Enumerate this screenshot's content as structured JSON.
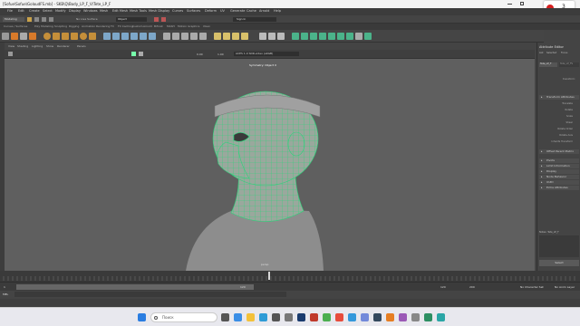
{
  "window": {
    "title": "[Sofue\\Sofue\\GoloudFS.mb] - SKB\\Q\\Body_LP_F_V\\Tete_LP_F"
  },
  "recording": {
    "count": "3"
  },
  "menu": [
    "File",
    "Edit",
    "Create",
    "Select",
    "Modify",
    "Display",
    "Windows",
    "Mesh",
    "Edit Mesh",
    "Mesh Tools",
    "Mesh Display",
    "Curves",
    "Surfaces",
    "Deform",
    "UV",
    "Generate",
    "Cache",
    "Arnold",
    "Help"
  ],
  "status": {
    "workspace": "Modeling",
    "live_surface": "No Live Surface",
    "object": "Object",
    "sign_in": "Sign In"
  },
  "shelf_tabs": [
    "Curves / Surfaces",
    "Poly Modeling",
    "Sculpting",
    "Rigging",
    "Animation",
    "Rendering",
    "FX",
    "FX Caching",
    "Custom",
    "Arnold",
    "Bifrost",
    "MASH",
    "Motion Graphics",
    "XGen"
  ],
  "panel_menu": [
    "View",
    "Shading",
    "Lighting",
    "Show",
    "Renderer",
    "Panels"
  ],
  "panel_tools": {
    "near": "0.00",
    "far": "1.00",
    "colorspace": "ACES 1.0 SDR-video (sRGB)"
  },
  "viewport": {
    "label": "Symmetry: Object X",
    "camera": "persp"
  },
  "attribute_editor": {
    "title": "Attribute Editor",
    "tabs": [
      "List",
      "Selected",
      "Focus",
      "Attributes",
      "Show",
      "Help"
    ],
    "nodes": [
      "Tete_LP_F",
      "Tete_LP_FS"
    ],
    "transform_label": "transform:",
    "sections": [
      "Transform Attributes",
      "Pivots",
      "Limit Information",
      "Display",
      "Node Behavior",
      "UUID",
      "Extra Attributes"
    ],
    "fields": [
      "Translate",
      "Rotate",
      "Scale",
      "Shear",
      "Rotate Order",
      "Rotate Axis",
      "Inherits Transform"
    ],
    "offset_section": "Offset Parent Matrix",
    "notes_label": "Notes: Tete_LP_F",
    "select_button": "Select"
  },
  "timeline": {
    "current_frame": "120",
    "start": "1",
    "end": "120",
    "range_end": "200",
    "character_set": "No Character Set",
    "anim_layer": "No Anim Layer"
  },
  "cmd": {
    "lang": "MEL"
  },
  "taskbar": {
    "search_placeholder": "Поиск"
  },
  "colors": {
    "wire": "#2bd47a",
    "mesh": "#9a9a9a",
    "viewport": "#5f5f5f",
    "rec": "#d62020"
  }
}
